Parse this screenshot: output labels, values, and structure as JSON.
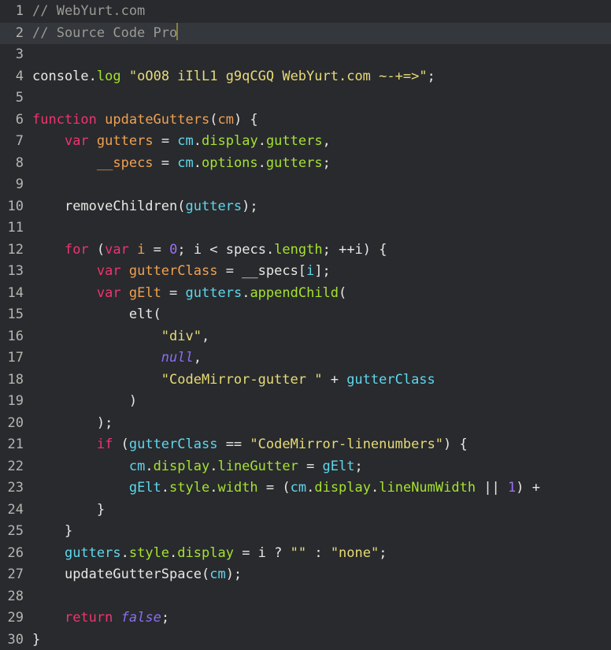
{
  "editor": {
    "theme_name": "monokai-dark",
    "background_color": "#282a2e",
    "active_line_color": "#34373b",
    "gutter_color": "#b5b6b0",
    "cursor_color": "#8a8232",
    "active_line_number": 2,
    "cursor_line": 2,
    "cursor_after_text": "Pro",
    "total_lines": 30,
    "token_colors": {
      "comment": "#9a9a95",
      "keyword": "#f0346e",
      "definition": "#f0a150",
      "string": "#e7db75",
      "number": "#a071f2",
      "atom": "#8a6ef2",
      "variable": "#5fd7eb",
      "property": "#a6e22e",
      "plain": "#e8e8e3"
    },
    "lines": [
      {
        "number": "1",
        "active": false,
        "tokens": [
          {
            "t": "// WebYurt.com",
            "c": "comment"
          }
        ]
      },
      {
        "number": "2",
        "active": true,
        "tokens": [
          {
            "t": "// Source Code Pro",
            "c": "comment"
          },
          {
            "t": "",
            "c": "cursor"
          }
        ]
      },
      {
        "number": "3",
        "active": false,
        "tokens": []
      },
      {
        "number": "4",
        "active": false,
        "tokens": [
          {
            "t": "console",
            "c": "plain"
          },
          {
            "t": ".",
            "c": "plain"
          },
          {
            "t": "log",
            "c": "prop"
          },
          {
            "t": " ",
            "c": "plain"
          },
          {
            "t": "\"oO08 iIlL1 g9qCGQ WebYurt.com ~-+=>\"",
            "c": "string"
          },
          {
            "t": ";",
            "c": "plain"
          }
        ]
      },
      {
        "number": "5",
        "active": false,
        "tokens": []
      },
      {
        "number": "6",
        "active": false,
        "tokens": [
          {
            "t": "function",
            "c": "keyword"
          },
          {
            "t": " ",
            "c": "plain"
          },
          {
            "t": "updateGutters",
            "c": "def"
          },
          {
            "t": "(",
            "c": "plain"
          },
          {
            "t": "cm",
            "c": "def"
          },
          {
            "t": ") {",
            "c": "plain"
          }
        ]
      },
      {
        "number": "7",
        "active": false,
        "tokens": [
          {
            "t": "    ",
            "c": "plain"
          },
          {
            "t": "var",
            "c": "keyword"
          },
          {
            "t": " ",
            "c": "plain"
          },
          {
            "t": "gutters",
            "c": "def"
          },
          {
            "t": " = ",
            "c": "plain"
          },
          {
            "t": "cm",
            "c": "var"
          },
          {
            "t": ".",
            "c": "plain"
          },
          {
            "t": "display",
            "c": "prop"
          },
          {
            "t": ".",
            "c": "plain"
          },
          {
            "t": "gutters",
            "c": "prop"
          },
          {
            "t": ",",
            "c": "plain"
          }
        ]
      },
      {
        "number": "8",
        "active": false,
        "tokens": [
          {
            "t": "        ",
            "c": "plain"
          },
          {
            "t": "__specs",
            "c": "def"
          },
          {
            "t": " = ",
            "c": "plain"
          },
          {
            "t": "cm",
            "c": "var"
          },
          {
            "t": ".",
            "c": "plain"
          },
          {
            "t": "options",
            "c": "prop"
          },
          {
            "t": ".",
            "c": "plain"
          },
          {
            "t": "gutters",
            "c": "prop"
          },
          {
            "t": ";",
            "c": "plain"
          }
        ]
      },
      {
        "number": "9",
        "active": false,
        "tokens": []
      },
      {
        "number": "10",
        "active": false,
        "tokens": [
          {
            "t": "    ",
            "c": "plain"
          },
          {
            "t": "removeChildren",
            "c": "plain"
          },
          {
            "t": "(",
            "c": "plain"
          },
          {
            "t": "gutters",
            "c": "var"
          },
          {
            "t": ");",
            "c": "plain"
          }
        ]
      },
      {
        "number": "11",
        "active": false,
        "tokens": []
      },
      {
        "number": "12",
        "active": false,
        "tokens": [
          {
            "t": "    ",
            "c": "plain"
          },
          {
            "t": "for",
            "c": "keyword"
          },
          {
            "t": " (",
            "c": "plain"
          },
          {
            "t": "var",
            "c": "keyword"
          },
          {
            "t": " ",
            "c": "plain"
          },
          {
            "t": "i",
            "c": "def"
          },
          {
            "t": " = ",
            "c": "plain"
          },
          {
            "t": "0",
            "c": "number"
          },
          {
            "t": "; i < specs",
            "c": "plain"
          },
          {
            "t": ".",
            "c": "plain"
          },
          {
            "t": "length",
            "c": "prop"
          },
          {
            "t": "; ++i) {",
            "c": "plain"
          }
        ]
      },
      {
        "number": "13",
        "active": false,
        "tokens": [
          {
            "t": "        ",
            "c": "plain"
          },
          {
            "t": "var",
            "c": "keyword"
          },
          {
            "t": " ",
            "c": "plain"
          },
          {
            "t": "gutterClass",
            "c": "def"
          },
          {
            "t": " = __specs[",
            "c": "plain"
          },
          {
            "t": "i",
            "c": "var"
          },
          {
            "t": "];",
            "c": "plain"
          }
        ]
      },
      {
        "number": "14",
        "active": false,
        "tokens": [
          {
            "t": "        ",
            "c": "plain"
          },
          {
            "t": "var",
            "c": "keyword"
          },
          {
            "t": " ",
            "c": "plain"
          },
          {
            "t": "gElt",
            "c": "def"
          },
          {
            "t": " = ",
            "c": "plain"
          },
          {
            "t": "gutters",
            "c": "var"
          },
          {
            "t": ".",
            "c": "plain"
          },
          {
            "t": "appendChild",
            "c": "prop"
          },
          {
            "t": "(",
            "c": "plain"
          }
        ]
      },
      {
        "number": "15",
        "active": false,
        "tokens": [
          {
            "t": "            ",
            "c": "plain"
          },
          {
            "t": "elt",
            "c": "plain"
          },
          {
            "t": "(",
            "c": "plain"
          }
        ]
      },
      {
        "number": "16",
        "active": false,
        "tokens": [
          {
            "t": "                ",
            "c": "plain"
          },
          {
            "t": "\"div\"",
            "c": "string"
          },
          {
            "t": ",",
            "c": "plain"
          }
        ]
      },
      {
        "number": "17",
        "active": false,
        "tokens": [
          {
            "t": "                ",
            "c": "plain"
          },
          {
            "t": "null",
            "c": "atom"
          },
          {
            "t": ",",
            "c": "plain"
          }
        ]
      },
      {
        "number": "18",
        "active": false,
        "tokens": [
          {
            "t": "                ",
            "c": "plain"
          },
          {
            "t": "\"CodeMirror-gutter \"",
            "c": "string"
          },
          {
            "t": " + ",
            "c": "plain"
          },
          {
            "t": "gutterClass",
            "c": "var"
          }
        ]
      },
      {
        "number": "19",
        "active": false,
        "tokens": [
          {
            "t": "            ",
            "c": "plain"
          },
          {
            "t": ")",
            "c": "plain"
          }
        ]
      },
      {
        "number": "20",
        "active": false,
        "tokens": [
          {
            "t": "        ",
            "c": "plain"
          },
          {
            "t": ");",
            "c": "plain"
          }
        ]
      },
      {
        "number": "21",
        "active": false,
        "tokens": [
          {
            "t": "        ",
            "c": "plain"
          },
          {
            "t": "if",
            "c": "keyword"
          },
          {
            "t": " (",
            "c": "plain"
          },
          {
            "t": "gutterClass",
            "c": "var"
          },
          {
            "t": " == ",
            "c": "plain"
          },
          {
            "t": "\"CodeMirror-linenumbers\"",
            "c": "string"
          },
          {
            "t": ") {",
            "c": "plain"
          }
        ]
      },
      {
        "number": "22",
        "active": false,
        "tokens": [
          {
            "t": "            ",
            "c": "plain"
          },
          {
            "t": "cm",
            "c": "var"
          },
          {
            "t": ".",
            "c": "plain"
          },
          {
            "t": "display",
            "c": "prop"
          },
          {
            "t": ".",
            "c": "plain"
          },
          {
            "t": "lineGutter",
            "c": "prop"
          },
          {
            "t": " = ",
            "c": "plain"
          },
          {
            "t": "gElt",
            "c": "var"
          },
          {
            "t": ";",
            "c": "plain"
          }
        ]
      },
      {
        "number": "23",
        "active": false,
        "tokens": [
          {
            "t": "            ",
            "c": "plain"
          },
          {
            "t": "gElt",
            "c": "var"
          },
          {
            "t": ".",
            "c": "plain"
          },
          {
            "t": "style",
            "c": "prop"
          },
          {
            "t": ".",
            "c": "plain"
          },
          {
            "t": "width",
            "c": "prop"
          },
          {
            "t": " = (",
            "c": "plain"
          },
          {
            "t": "cm",
            "c": "var"
          },
          {
            "t": ".",
            "c": "plain"
          },
          {
            "t": "display",
            "c": "prop"
          },
          {
            "t": ".",
            "c": "plain"
          },
          {
            "t": "lineNumWidth",
            "c": "prop"
          },
          {
            "t": " || ",
            "c": "plain"
          },
          {
            "t": "1",
            "c": "number"
          },
          {
            "t": ") +",
            "c": "plain"
          }
        ]
      },
      {
        "number": "24",
        "active": false,
        "tokens": [
          {
            "t": "        ",
            "c": "plain"
          },
          {
            "t": "}",
            "c": "plain"
          }
        ]
      },
      {
        "number": "25",
        "active": false,
        "tokens": [
          {
            "t": "    ",
            "c": "plain"
          },
          {
            "t": "}",
            "c": "plain"
          }
        ]
      },
      {
        "number": "26",
        "active": false,
        "tokens": [
          {
            "t": "    ",
            "c": "plain"
          },
          {
            "t": "gutters",
            "c": "var"
          },
          {
            "t": ".",
            "c": "plain"
          },
          {
            "t": "style",
            "c": "prop"
          },
          {
            "t": ".",
            "c": "plain"
          },
          {
            "t": "display",
            "c": "prop"
          },
          {
            "t": " = i ? ",
            "c": "plain"
          },
          {
            "t": "\"\"",
            "c": "string"
          },
          {
            "t": " : ",
            "c": "plain"
          },
          {
            "t": "\"none\"",
            "c": "string"
          },
          {
            "t": ";",
            "c": "plain"
          }
        ]
      },
      {
        "number": "27",
        "active": false,
        "tokens": [
          {
            "t": "    ",
            "c": "plain"
          },
          {
            "t": "updateGutterSpace",
            "c": "plain"
          },
          {
            "t": "(",
            "c": "plain"
          },
          {
            "t": "cm",
            "c": "var"
          },
          {
            "t": ");",
            "c": "plain"
          }
        ]
      },
      {
        "number": "28",
        "active": false,
        "tokens": []
      },
      {
        "number": "29",
        "active": false,
        "tokens": [
          {
            "t": "    ",
            "c": "plain"
          },
          {
            "t": "return",
            "c": "keyword"
          },
          {
            "t": " ",
            "c": "plain"
          },
          {
            "t": "false",
            "c": "atom"
          },
          {
            "t": ";",
            "c": "plain"
          }
        ]
      },
      {
        "number": "30",
        "active": false,
        "tokens": [
          {
            "t": "}",
            "c": "plain"
          }
        ]
      }
    ]
  }
}
